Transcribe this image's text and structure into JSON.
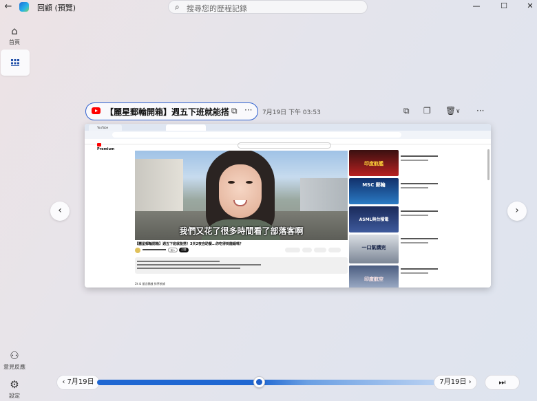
{
  "titlebar": {
    "back_icon": "back-arrow-icon",
    "app_title": "回顧 (預覽)",
    "search_placeholder": "搜尋您的歷程記錄",
    "minimize": "—",
    "maximize": "☐",
    "close": "✕"
  },
  "sidebar": {
    "home_label": "首頁",
    "timeline_label": "",
    "feedback_label": "意見反應",
    "settings_label": "設定"
  },
  "entry": {
    "title": "【麗星郵輪開箱】週五下班就能搭！3...",
    "more": "···",
    "time": "7月19日 下午 03:53"
  },
  "screenshot": {
    "tab1": "YouTube",
    "tab2": "",
    "tab3": "",
    "brand": "Premium",
    "subtitle": "我們又花了很多時間看了部落客啊",
    "video_title": "【麗星郵輪開箱】週五下班就能搭！3天2夜自助餐…你吃得到龍蝦嗎？",
    "join": "加入",
    "subscribe": "訂閱",
    "chips": "2k & 留言開啟     排序依據",
    "side_thumbs": [
      "印度航艦",
      "MSC 郵輪",
      "ASML與台積電",
      "一口氣講完",
      "印度航空"
    ]
  },
  "timeline": {
    "prev_label": "7月19日",
    "next_label": "7月19日",
    "prev_chevron": "‹",
    "next_chevron": "›",
    "position": 0.48
  },
  "colors": {
    "accent": "#1f67d2",
    "youtube_red": "#ff0000"
  }
}
